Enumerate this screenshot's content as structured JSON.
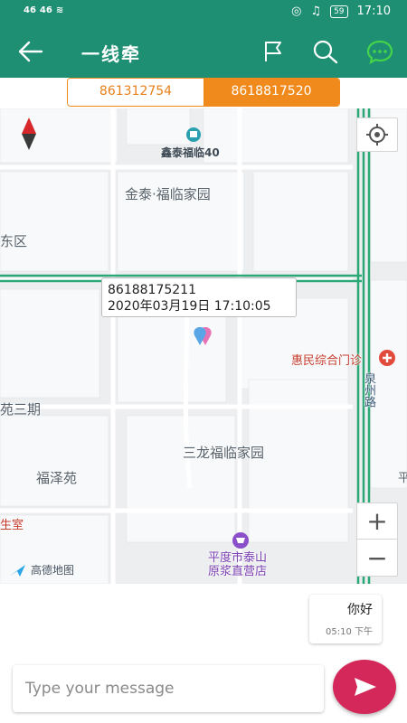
{
  "status_bar": {
    "signal_1": "46",
    "signal_2": "46",
    "battery": "59",
    "time": "17:10"
  },
  "app_bar": {
    "title": "一线牵",
    "icons": [
      "back-arrow-icon",
      "flag-icon",
      "search-icon",
      "chat-icon"
    ]
  },
  "tabs": [
    {
      "label": "861312754"
    },
    {
      "label": "8618817520"
    }
  ],
  "map": {
    "labels": {
      "poi_xintai": "鑫泰福临40",
      "jintai": "金泰·福临家园",
      "dongqu": "东区",
      "huimin": "惠民综合门诊",
      "quanzhou": "泉州路",
      "sanqi": "苑三期",
      "sanlong": "三龙福临家园",
      "fuze": "福泽苑",
      "shengshi": "生室",
      "ping": "平",
      "store": "平度市泰山原浆直营店"
    },
    "popup": {
      "number": "86188175211",
      "datetime": "2020年03月19日 17:10:05"
    },
    "logo_text": "高德地图",
    "zoom_in": "+",
    "zoom_out": "−",
    "road_color": "#2aa876"
  },
  "chat": {
    "message": "你好",
    "time": "05:10 下午"
  },
  "input": {
    "placeholder": "Type your message"
  },
  "colors": {
    "primary": "#1e8f73",
    "accent_orange": "#f08a1c",
    "send_button": "#d4275a",
    "chat_icon": "#44d34a"
  }
}
